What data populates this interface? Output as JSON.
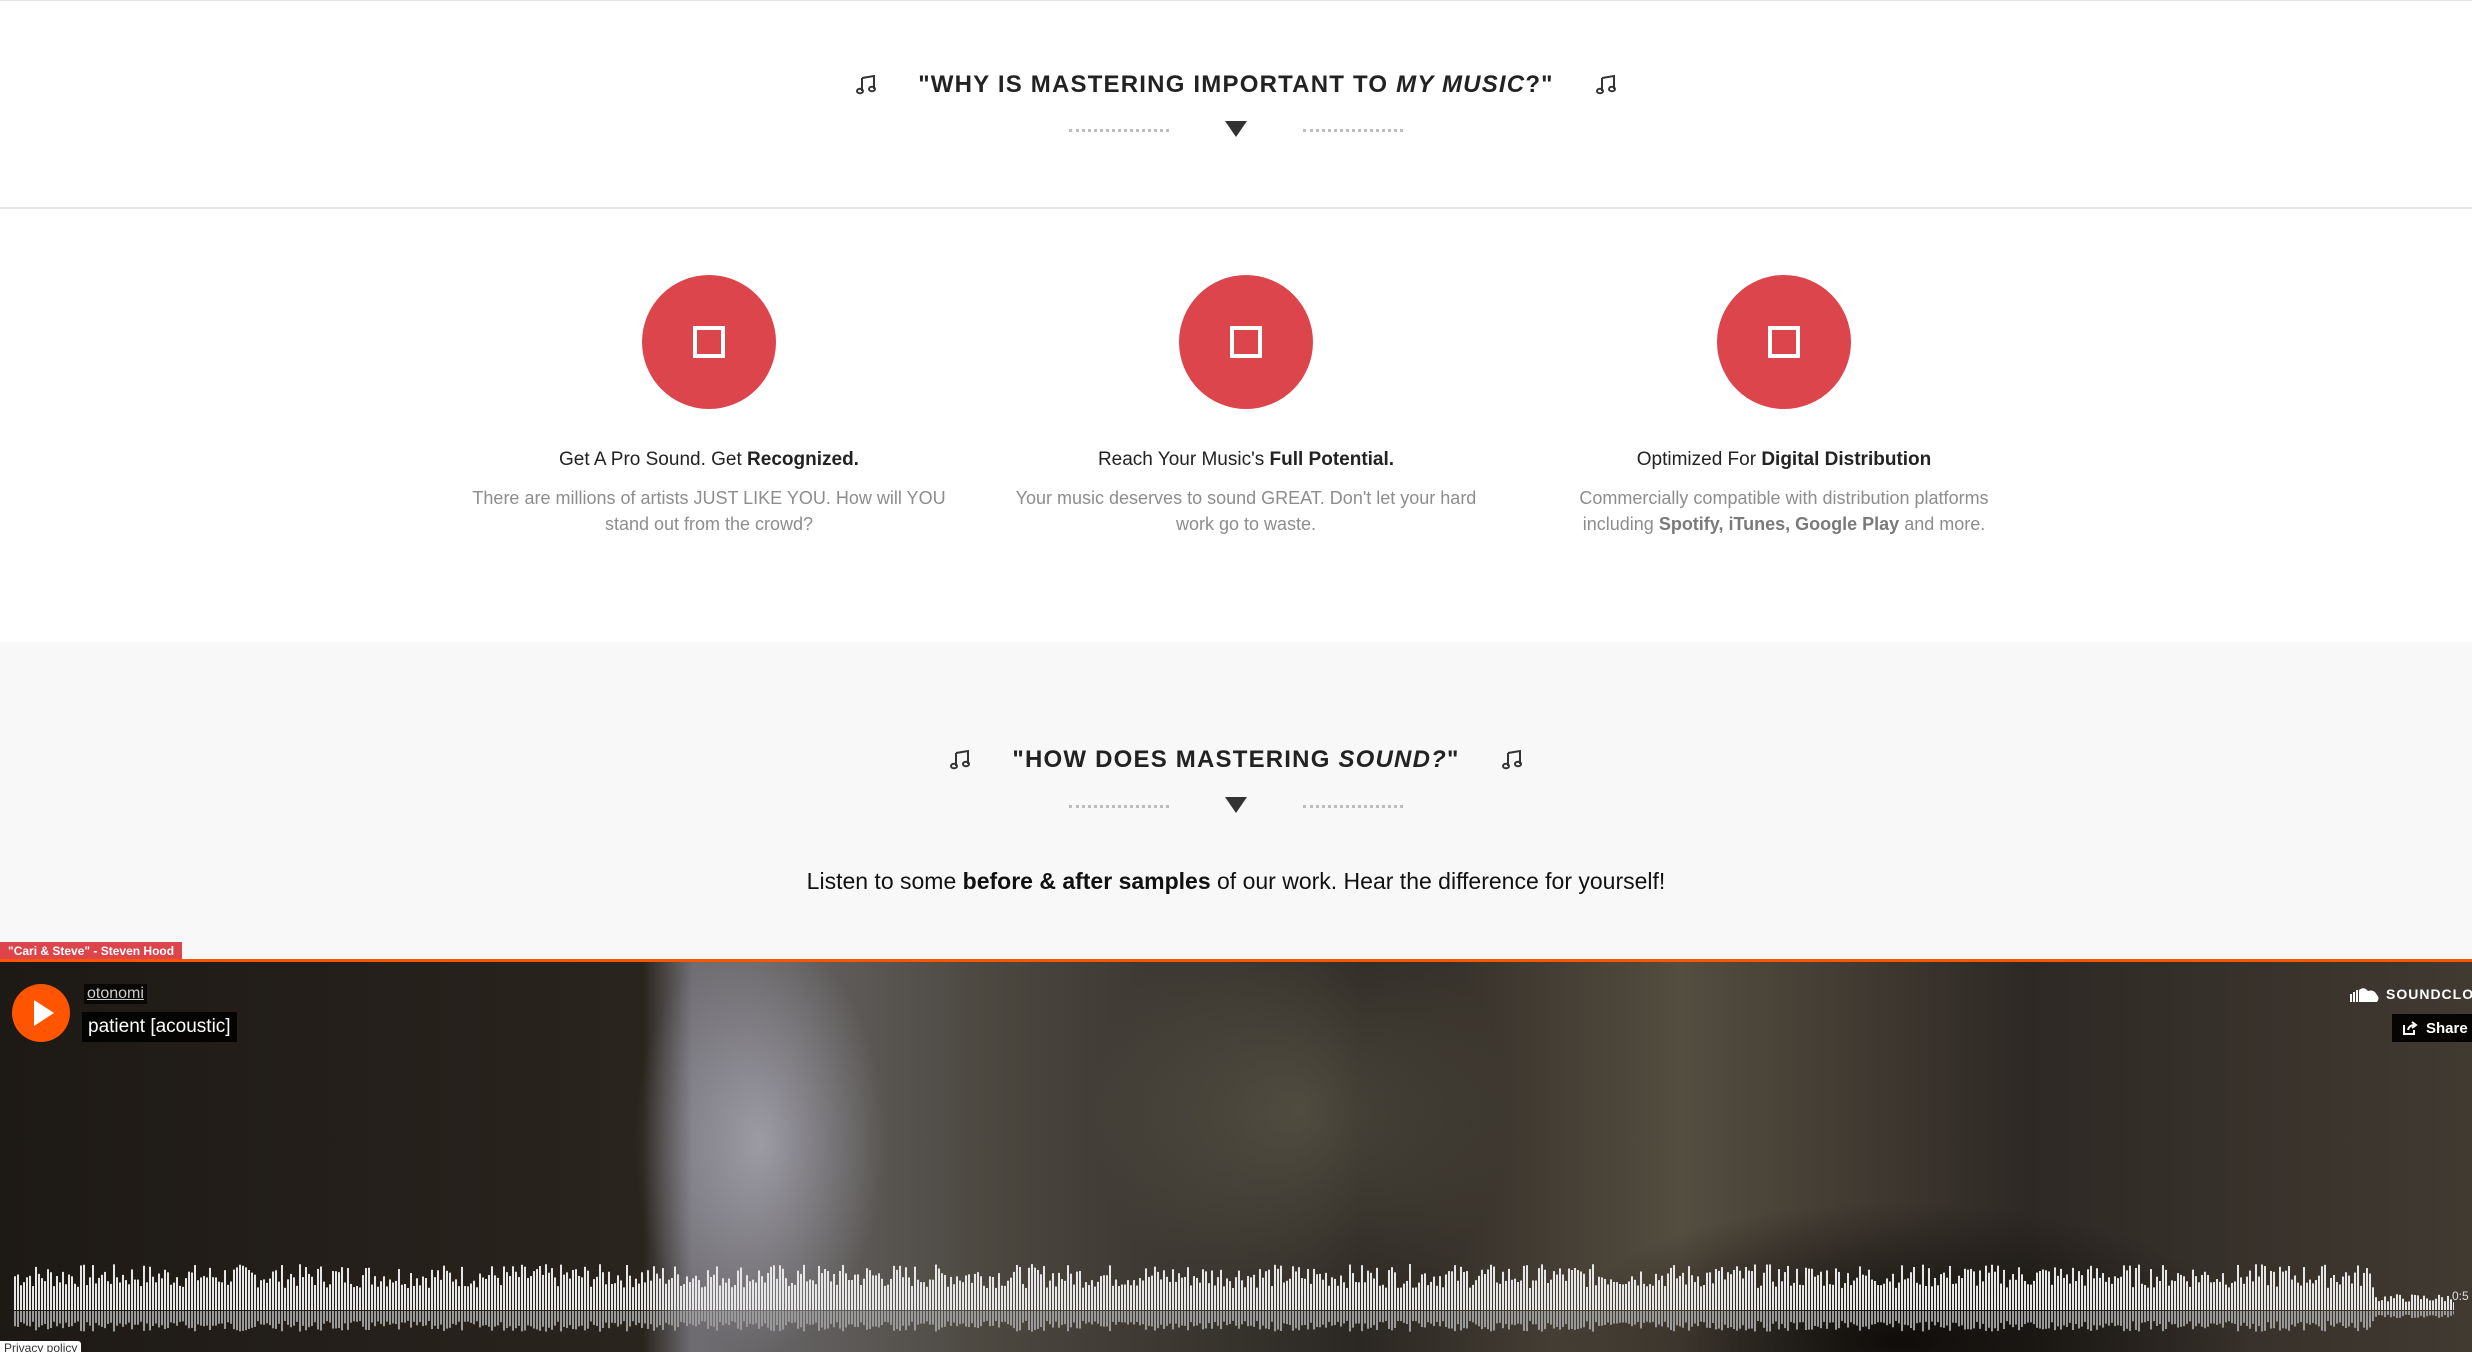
{
  "section1": {
    "heading_pre": "\"WHY IS MASTERING IMPORTANT TO ",
    "heading_em": "MY MUSIC",
    "heading_post": "?\""
  },
  "features": [
    {
      "title_pre": "Get A Pro Sound. Get ",
      "title_bold": "Recognized.",
      "line1": "There are millions of artists JUST LIKE YOU. How will YOU",
      "line2": "stand out from the crowd?"
    },
    {
      "title_pre": "Reach Your Music's ",
      "title_bold": "Full Potential.",
      "line1": "Your music deserves to sound GREAT. Don't let your hard",
      "line2": "work go to waste."
    },
    {
      "title_pre": "Optimized For ",
      "title_bold": "Digital Distribution",
      "line1": "Commercially compatible with distribution platforms",
      "line2_pre": "including ",
      "line2_bold": "Spotify, iTunes, Google Play",
      "line2_post": " and more."
    }
  ],
  "section2": {
    "heading_pre": "\"HOW DOES MASTERING ",
    "heading_em": "SOUND?",
    "heading_post": "\"",
    "intro_pre": "Listen to some ",
    "intro_bold": "before & after samples",
    "intro_post": " of our work. Hear the difference for yourself!"
  },
  "player": {
    "track_tag": "\"Cari & Steve\" - Steven Hood",
    "uploader": "otonomi",
    "title": "patient [acoustic]",
    "brand": "SOUNDCLOUD",
    "share_label": "Share",
    "time": "0:5",
    "privacy": "Privacy policy"
  },
  "colors": {
    "accent": "#dc454c",
    "soundcloud_orange": "#ff5500"
  },
  "icons": [
    "music-note-icon",
    "chevron-down-icon",
    "stop-square-icon",
    "play-icon",
    "soundcloud-cloud-icon",
    "share-icon"
  ]
}
